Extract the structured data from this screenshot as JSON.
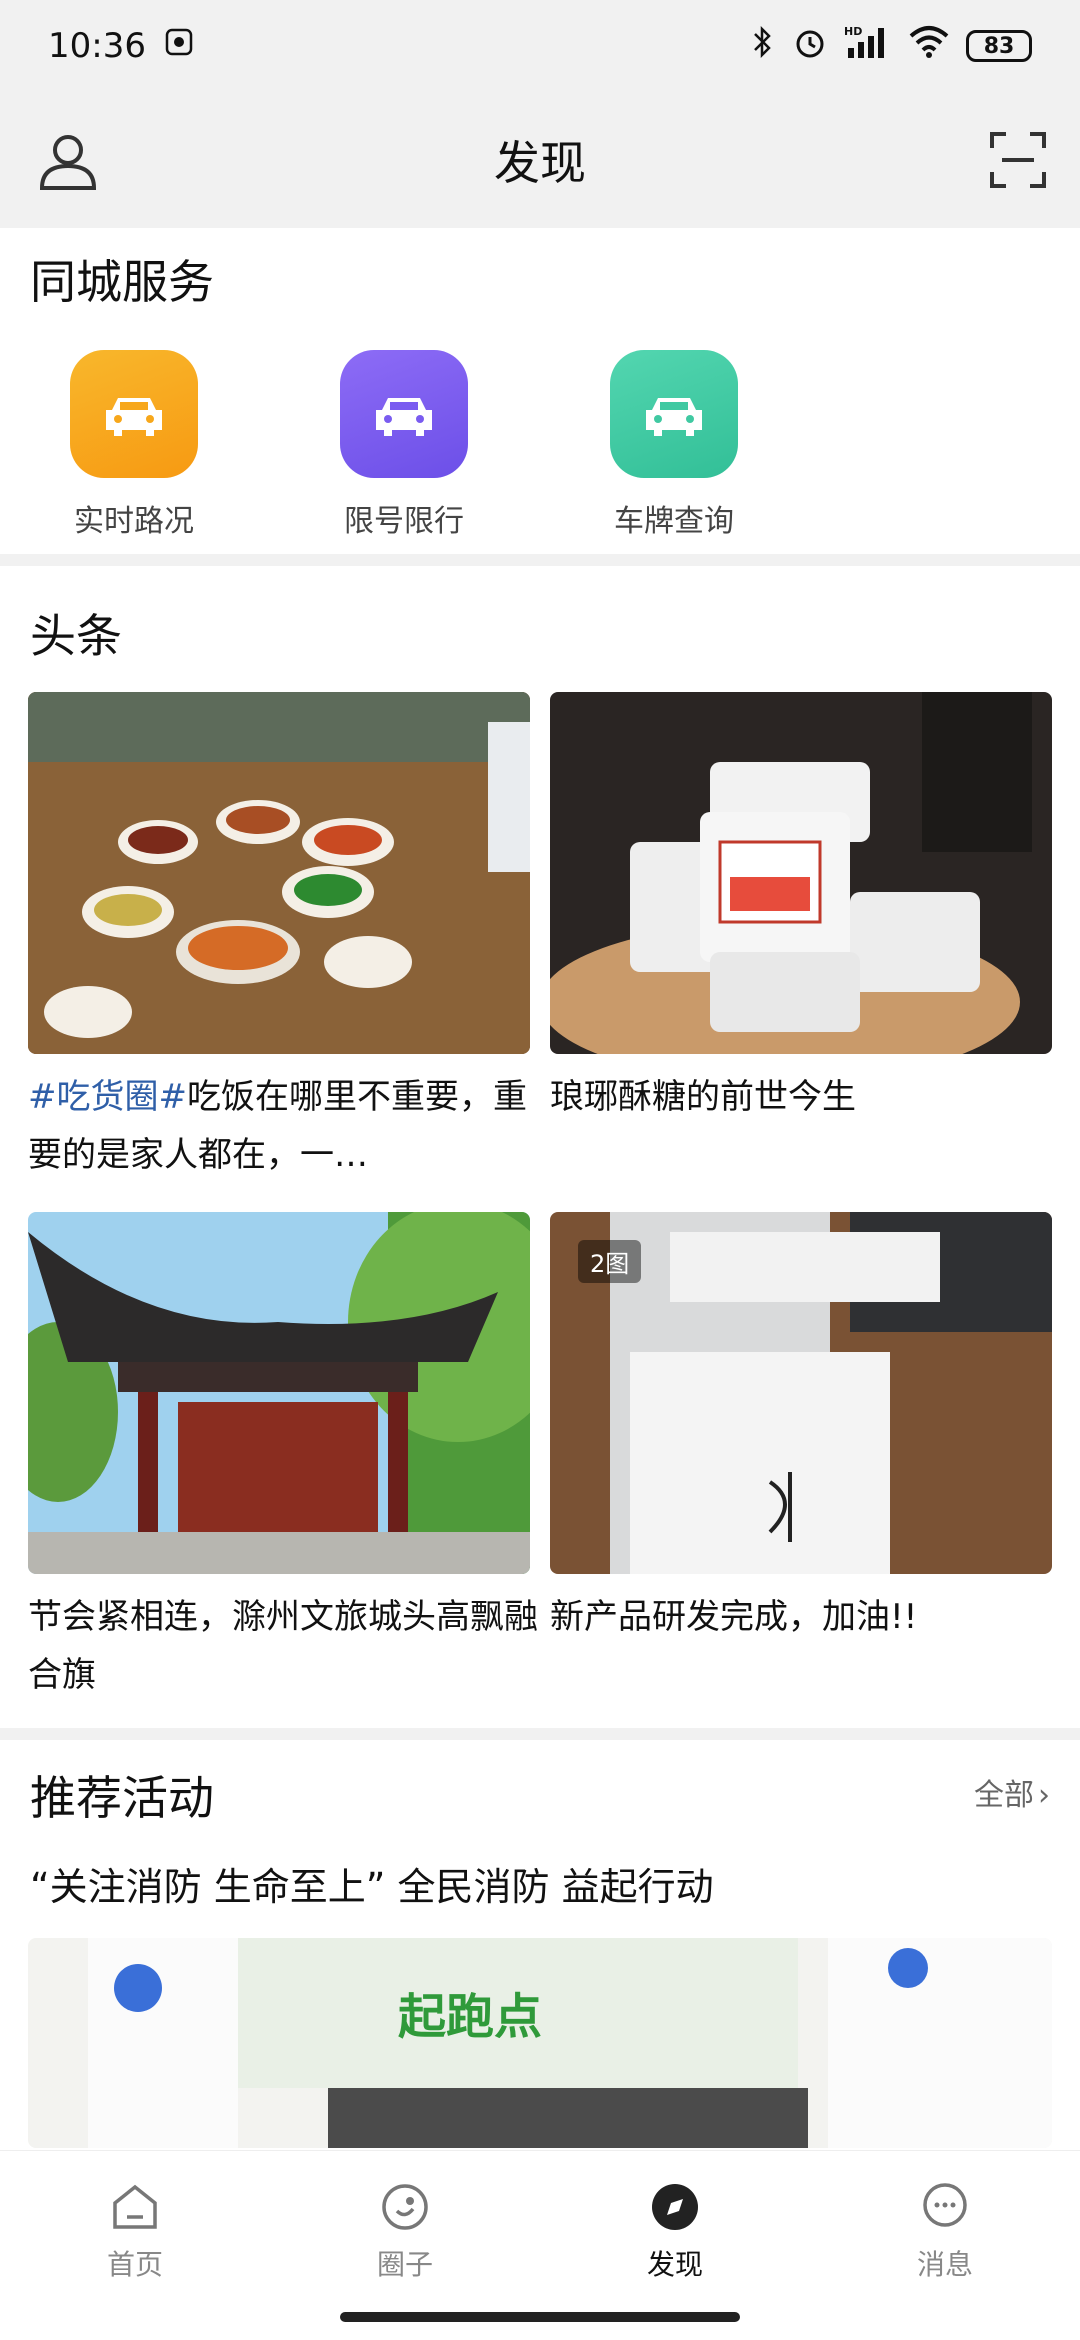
{
  "status": {
    "time": "10:36",
    "battery": "83",
    "hd": "HD"
  },
  "header": {
    "title": "发现"
  },
  "services": {
    "title": "同城服务",
    "items": [
      {
        "label": "实时路况",
        "color": "#f7a71b"
      },
      {
        "label": "限号限行",
        "color": "#7a5cf0"
      },
      {
        "label": "车牌查询",
        "color": "#40c9a2"
      }
    ]
  },
  "headlines": {
    "title": "头条",
    "cards": [
      {
        "hashtag": "#吃货圈#",
        "text": "吃饭在哪里不重要，重要的是家人都在，一…"
      },
      {
        "text": "琅琊酥糖的前世今生"
      },
      {
        "text": "节会紧相连，滁州文旅城头高飘融合旗"
      },
      {
        "badge": "2图",
        "text": "新产品研发完成，加油!!"
      }
    ]
  },
  "activity": {
    "title": "推荐活动",
    "more": "全部",
    "event_title": "“关注消防 生命至上” 全民消防 益起行动",
    "banner_text": "起跑点"
  },
  "nav": {
    "items": [
      {
        "label": "首页"
      },
      {
        "label": "圈子"
      },
      {
        "label": "发现"
      },
      {
        "label": "消息"
      }
    ]
  }
}
